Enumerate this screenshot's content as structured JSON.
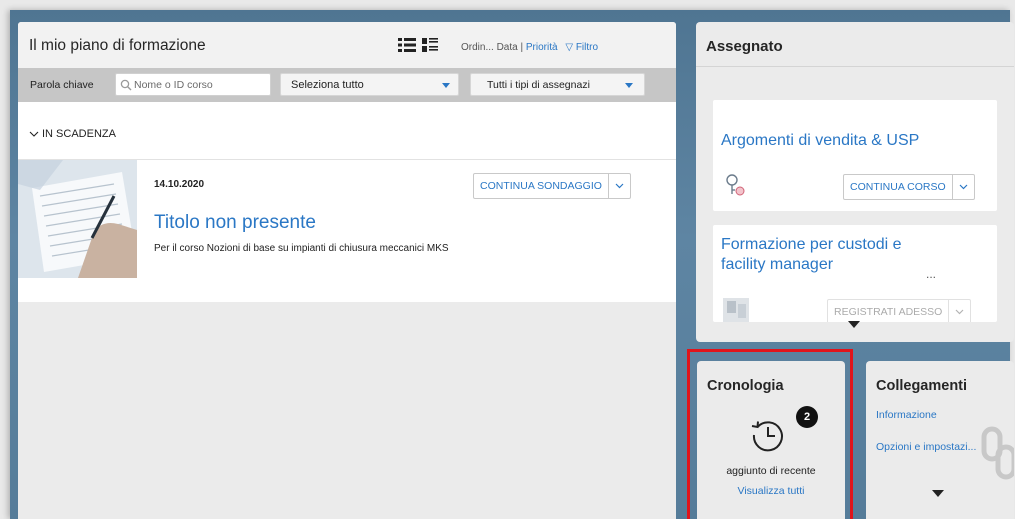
{
  "plan": {
    "title": "Il mio piano di formazione",
    "sort_label": "Ordin...",
    "sort_date": "Data",
    "sort_separator": "|",
    "sort_priority": "Priorità",
    "filter_label": "Filtro",
    "keyword_label": "Parola chiave",
    "keyword_placeholder": "Nome o ID corso",
    "select_all": "Seleziona tutto",
    "assignment_types": "Tutti i tipi di assegnazi",
    "section_heading": "IN SCADENZA",
    "course": {
      "date": "14.10.2020",
      "title": "Titolo non presente",
      "description": "Per il corso Nozioni di base su impianti di chiusura meccanici MKS",
      "action": "CONTINUA SONDAGGIO"
    }
  },
  "assigned": {
    "title": "Assegnato",
    "cards": [
      {
        "title": "Argomenti di vendita & USP",
        "action": "CONTINUA CORSO"
      },
      {
        "title_line1": "Formazione per custodi e",
        "title_line2": "facility manager",
        "ellipsis": "...",
        "action": "REGISTRATI ADESSO"
      }
    ]
  },
  "history": {
    "title": "Cronologia",
    "badge_count": "2",
    "recent_label": "aggiunto di recente",
    "view_all": "Visualizza tutti"
  },
  "links": {
    "title": "Collegamenti",
    "items": [
      "Informazione",
      "Opzioni e impostazi..."
    ]
  },
  "colors": {
    "accent": "#2a77c5",
    "highlight": "#e0141b",
    "background": "#5e85a3"
  }
}
